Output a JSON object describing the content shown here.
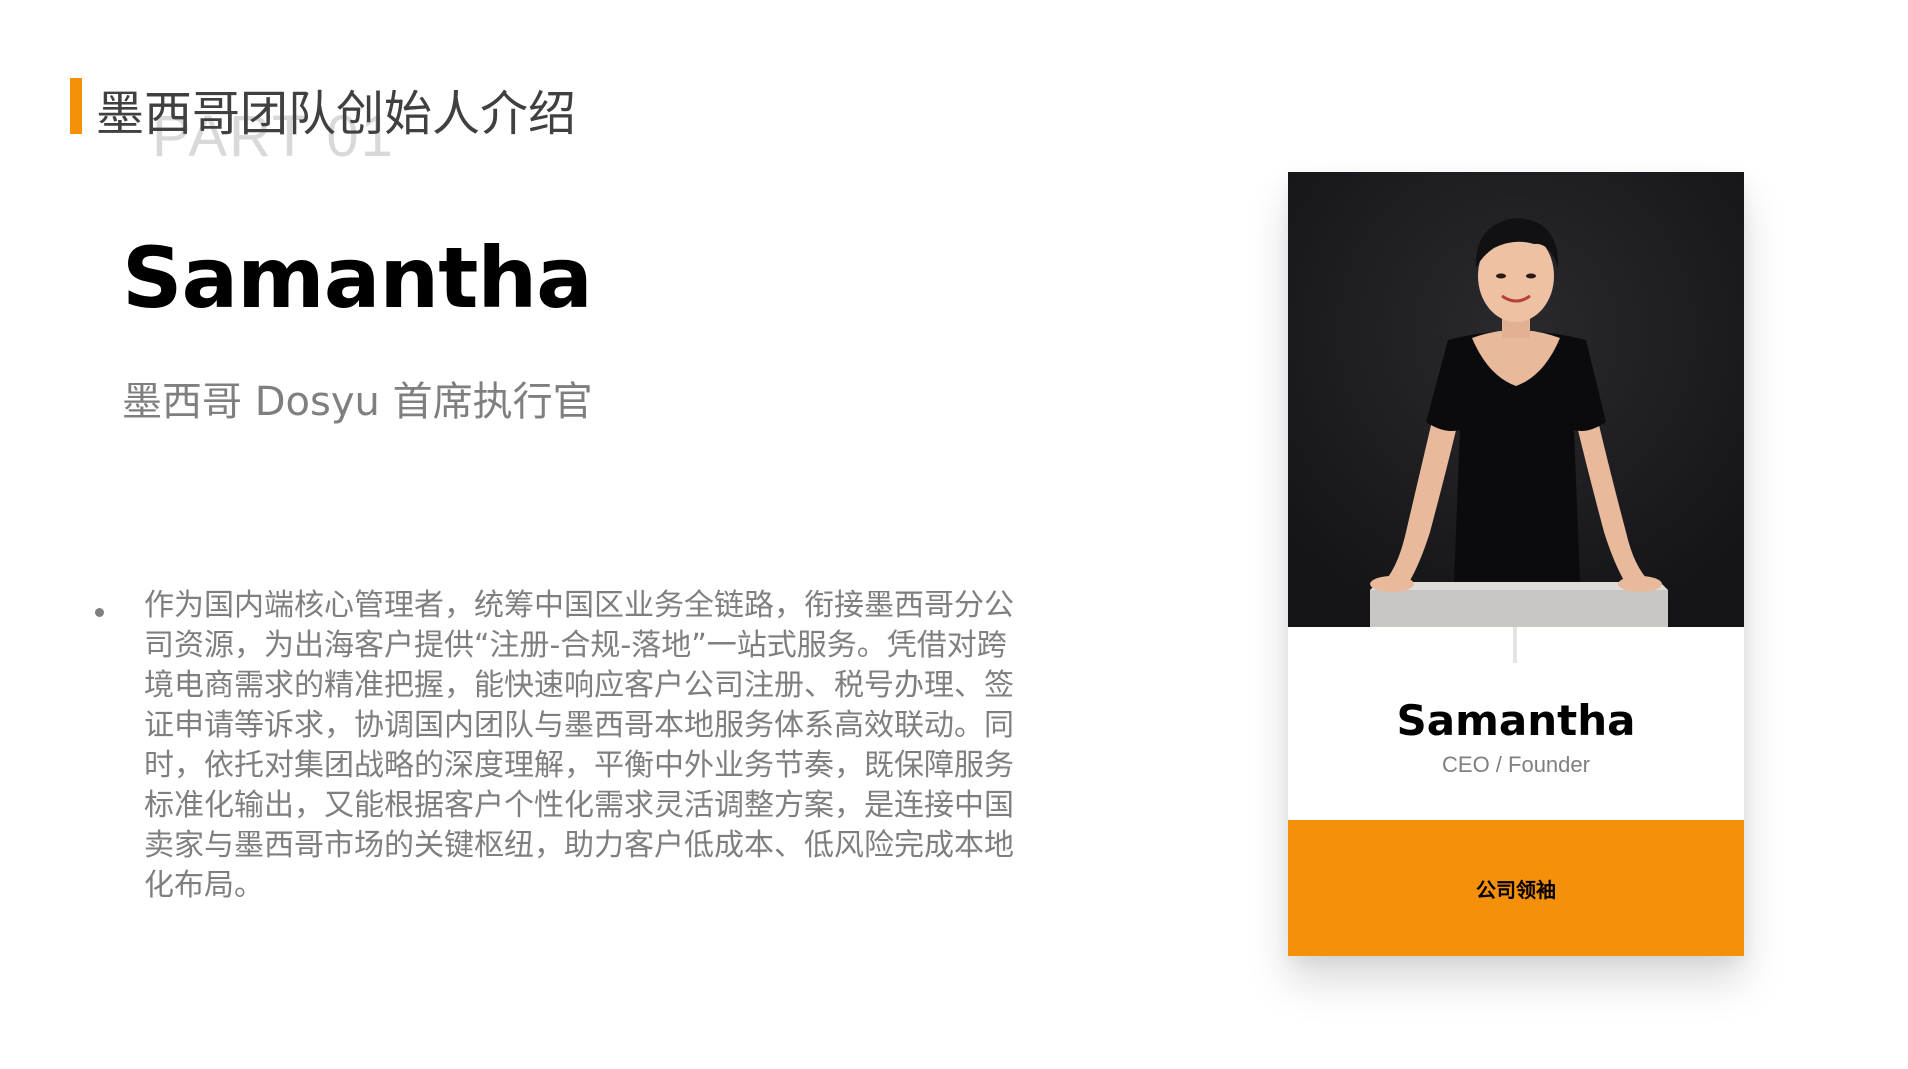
{
  "header": {
    "title": "墨西哥团队创始人介绍",
    "watermark": "PART 01"
  },
  "profile": {
    "name": "Samantha",
    "title": "墨西哥 Dosyu 首席执行官",
    "bio": "作为国内端核心管理者，统筹中国区业务全链路，衔接墨西哥分公司资源，为出海客户提供“注册-合规-落地”一站式服务。凭借对跨境电商需求的精准把握，能快速响应客户公司注册、税号办理、签证申请等诉求，协调国内团队与墨西哥本地服务体系高效联动。同时，依托对集团战略的深度理解，平衡中外业务节奏，既保障服务标准化输出，又能根据客户个性化需求灵活调整方案，是连接中国卖家与墨西哥市场的关键枢纽，助力客户低成本、低风险完成本地化布局。"
  },
  "card": {
    "name": "Samantha",
    "role": "CEO / Founder",
    "footer_label": "公司领袖"
  },
  "colors": {
    "accent": "#f5900a",
    "text_gray": "#7f7f7f",
    "heading": "#404040",
    "photo_background": "#16161a"
  }
}
